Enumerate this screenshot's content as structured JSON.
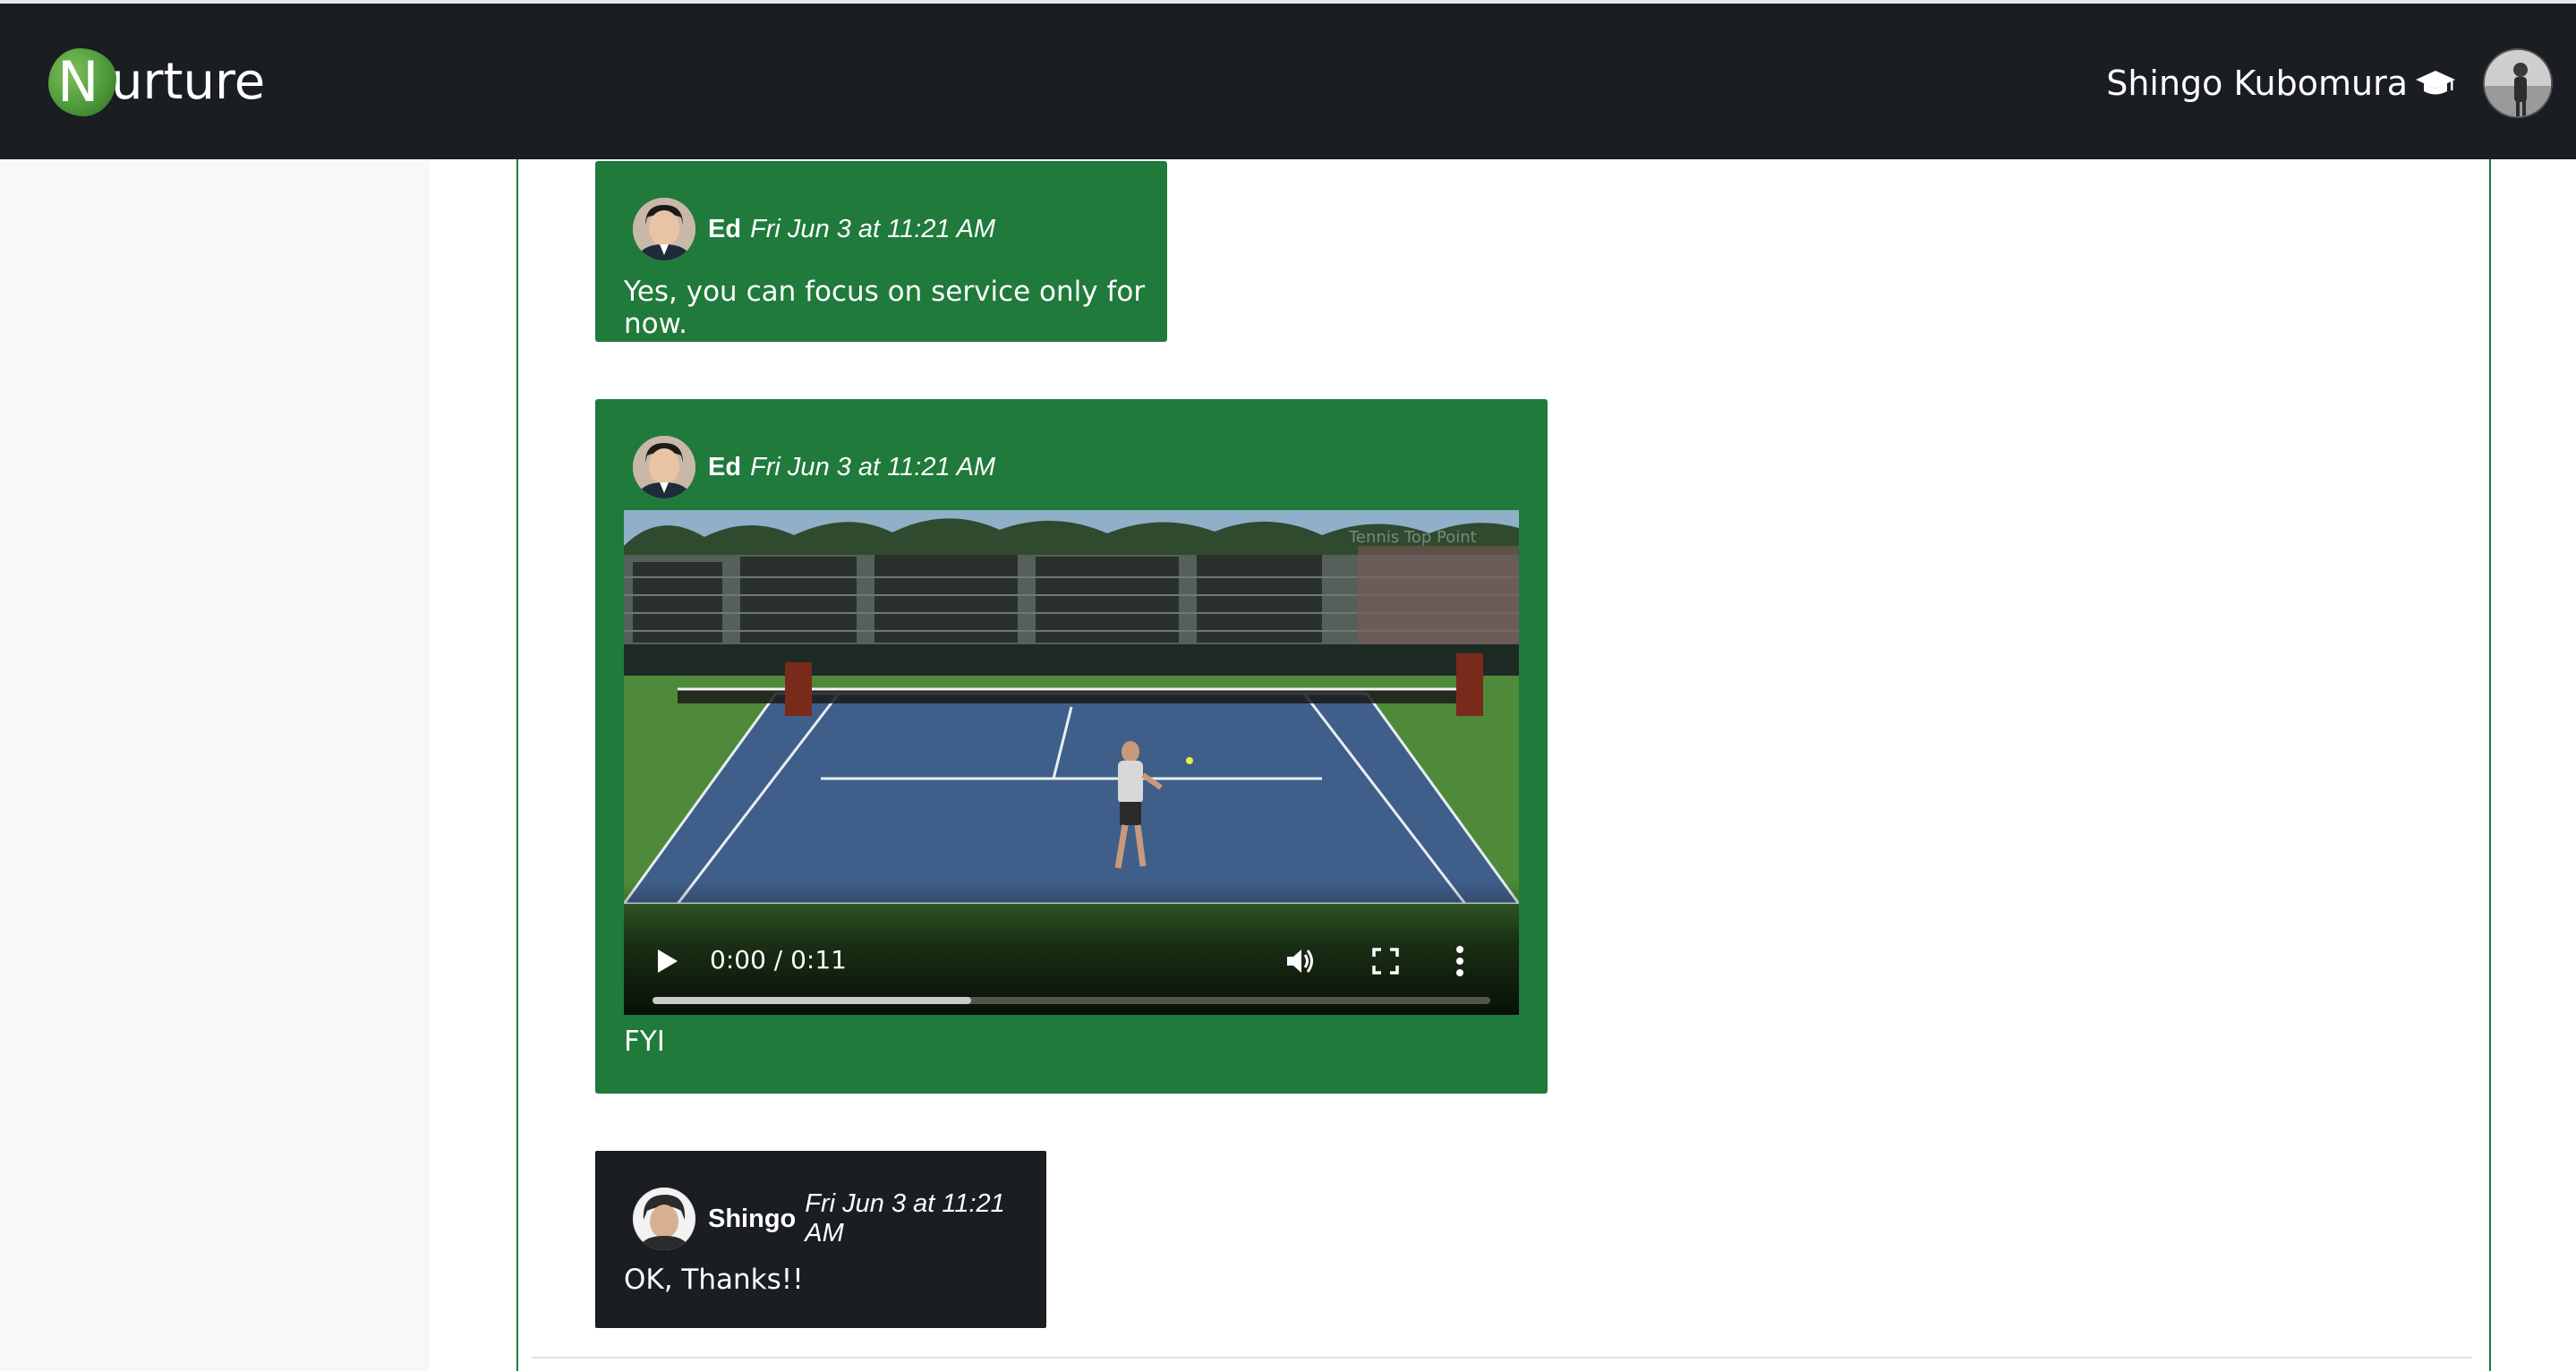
{
  "app": {
    "logo_initial": "N",
    "logo_text": "urture",
    "user_name": "Shingo Kubomura",
    "colors": {
      "navbar": "#1a1d21",
      "accent_green": "#1f7a3b",
      "sidebar": "#f7f8fa"
    }
  },
  "messages": [
    {
      "author": "Ed",
      "time": "Fri Jun 3 at 11:21 AM",
      "text": "Yes, you can focus on service only for now."
    },
    {
      "author": "Ed",
      "time": "Fri Jun 3 at 11:21 AM",
      "video": {
        "time_display": "0:00 / 0:11",
        "buffered": 0.38,
        "icons": [
          "play-icon",
          "volume-icon",
          "fullscreen-icon",
          "more-options-icon"
        ]
      },
      "text": "FYI"
    },
    {
      "author": "Shingo",
      "time": "Fri Jun 3 at 11:21 AM",
      "text": "OK, Thanks!!"
    }
  ]
}
